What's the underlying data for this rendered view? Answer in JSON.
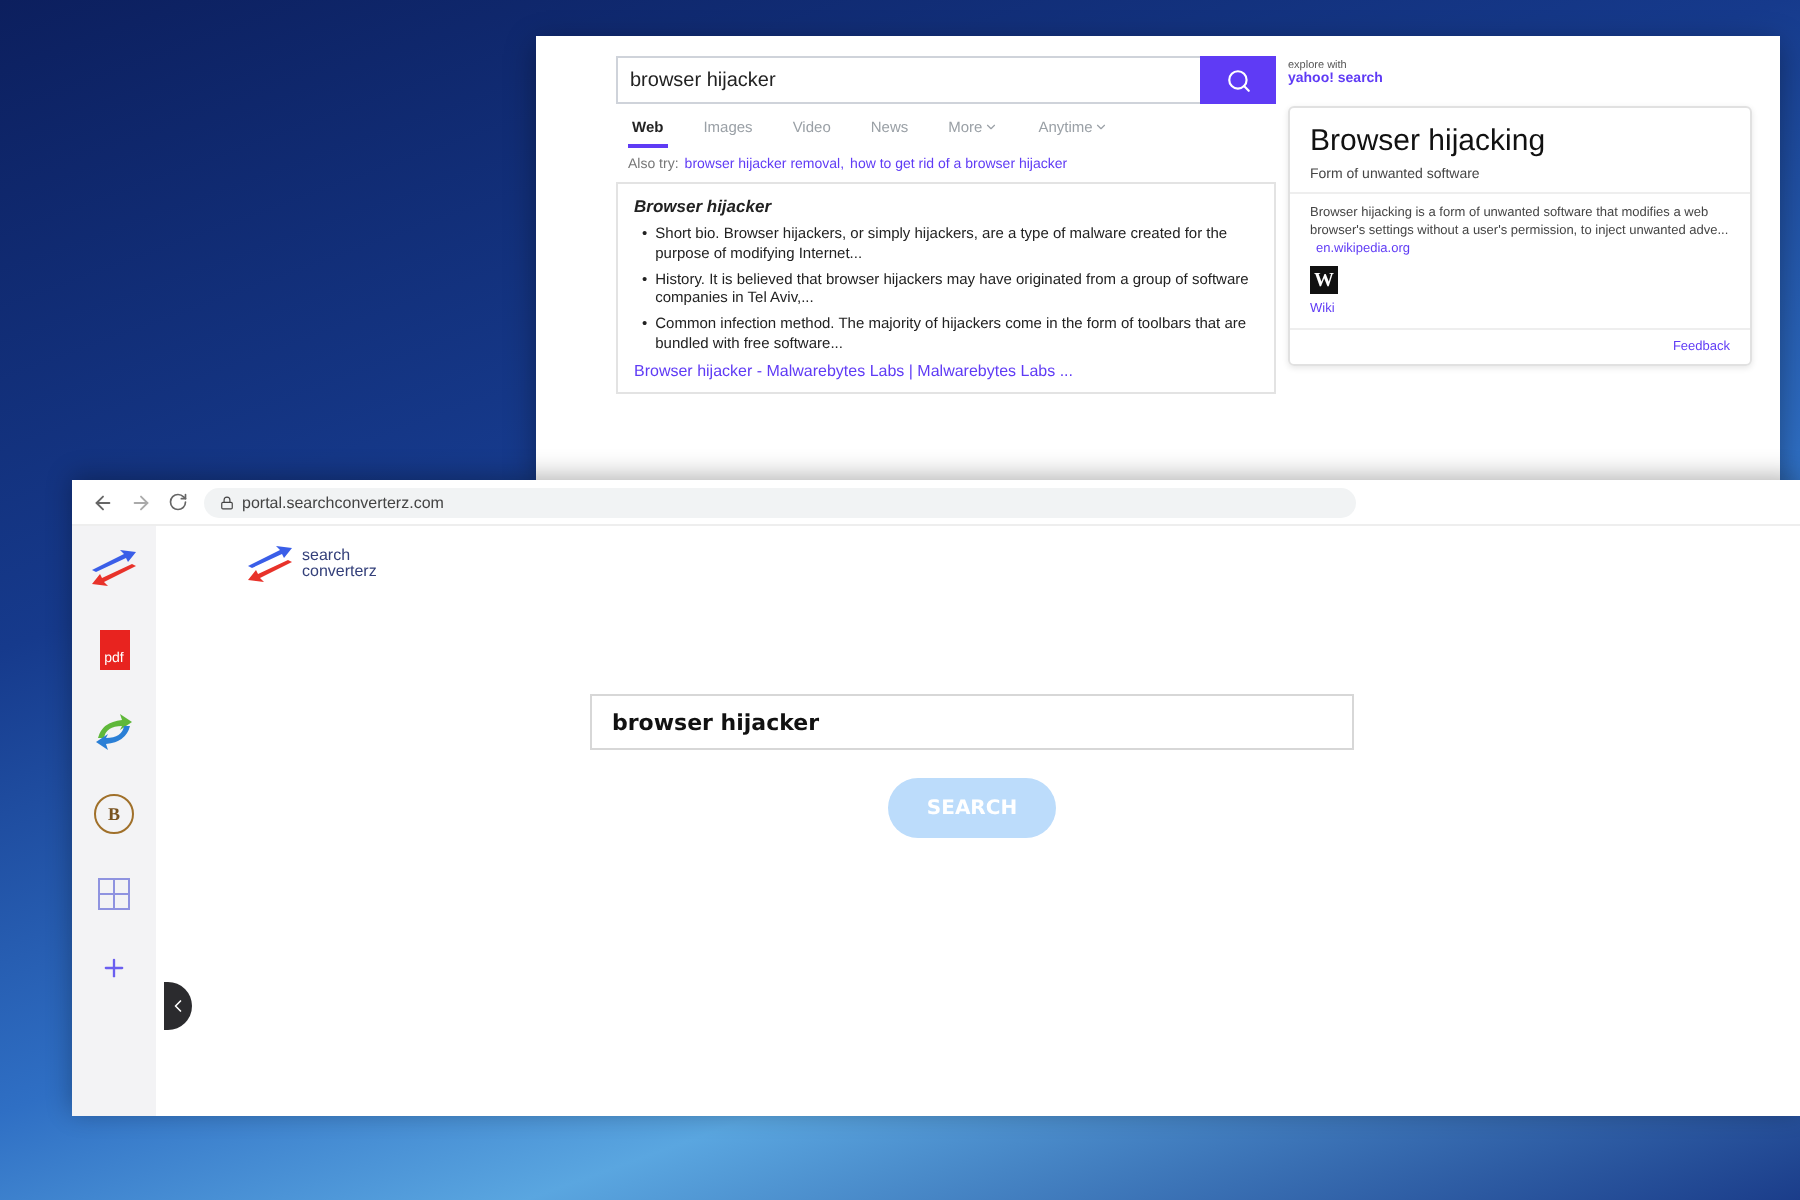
{
  "back_window": {
    "search": {
      "value": "browser hijacker"
    },
    "explore_label": "explore with",
    "brand": "yahoo! search",
    "tabs": [
      {
        "label": "Web",
        "selected": true,
        "dropdown": false
      },
      {
        "label": "Images",
        "selected": false,
        "dropdown": false
      },
      {
        "label": "Video",
        "selected": false,
        "dropdown": false
      },
      {
        "label": "News",
        "selected": false,
        "dropdown": false
      },
      {
        "label": "More",
        "selected": false,
        "dropdown": true
      },
      {
        "label": "Anytime",
        "selected": false,
        "dropdown": true
      }
    ],
    "also_try": {
      "label": "Also try:",
      "links": [
        "browser hijacker removal,",
        "how to get rid of a browser hijacker"
      ]
    },
    "result": {
      "title": "Browser hijacker",
      "marker": "•",
      "bullets": [
        "Short bio. Browser hijackers, or simply hijackers, are a type of malware created for the purpose of modifying Internet...",
        "History. It is believed that browser hijackers may have originated from a group of software companies in Tel Aviv,...",
        "Common infection method. The majority of hijackers come in the form of toolbars that are bundled with free software..."
      ],
      "link": "Browser hijacker - Malwarebytes Labs | Malwarebytes Labs ..."
    },
    "knowledge": {
      "title": "Browser hijacking",
      "subtitle": "Form of unwanted software",
      "description": "Browser hijacking is a form of unwanted software that modifies a web browser's settings without a user's permission, to inject unwanted adve...",
      "source_link": "en.wikipedia.org",
      "wiki_icon": "W",
      "wiki_label": "Wiki",
      "feedback": "Feedback"
    }
  },
  "front_window": {
    "url": "portal.searchconverterz.com",
    "sidebar": {
      "items": [
        {
          "kind": "logo"
        },
        {
          "kind": "pdf",
          "label": "pdf"
        },
        {
          "kind": "sync"
        },
        {
          "kind": "coin",
          "label": "B"
        },
        {
          "kind": "grid"
        },
        {
          "kind": "plus"
        }
      ]
    },
    "logo_text": "search converterz",
    "search": {
      "value": "browser hijacker"
    },
    "search_button": "SEARCH"
  }
}
